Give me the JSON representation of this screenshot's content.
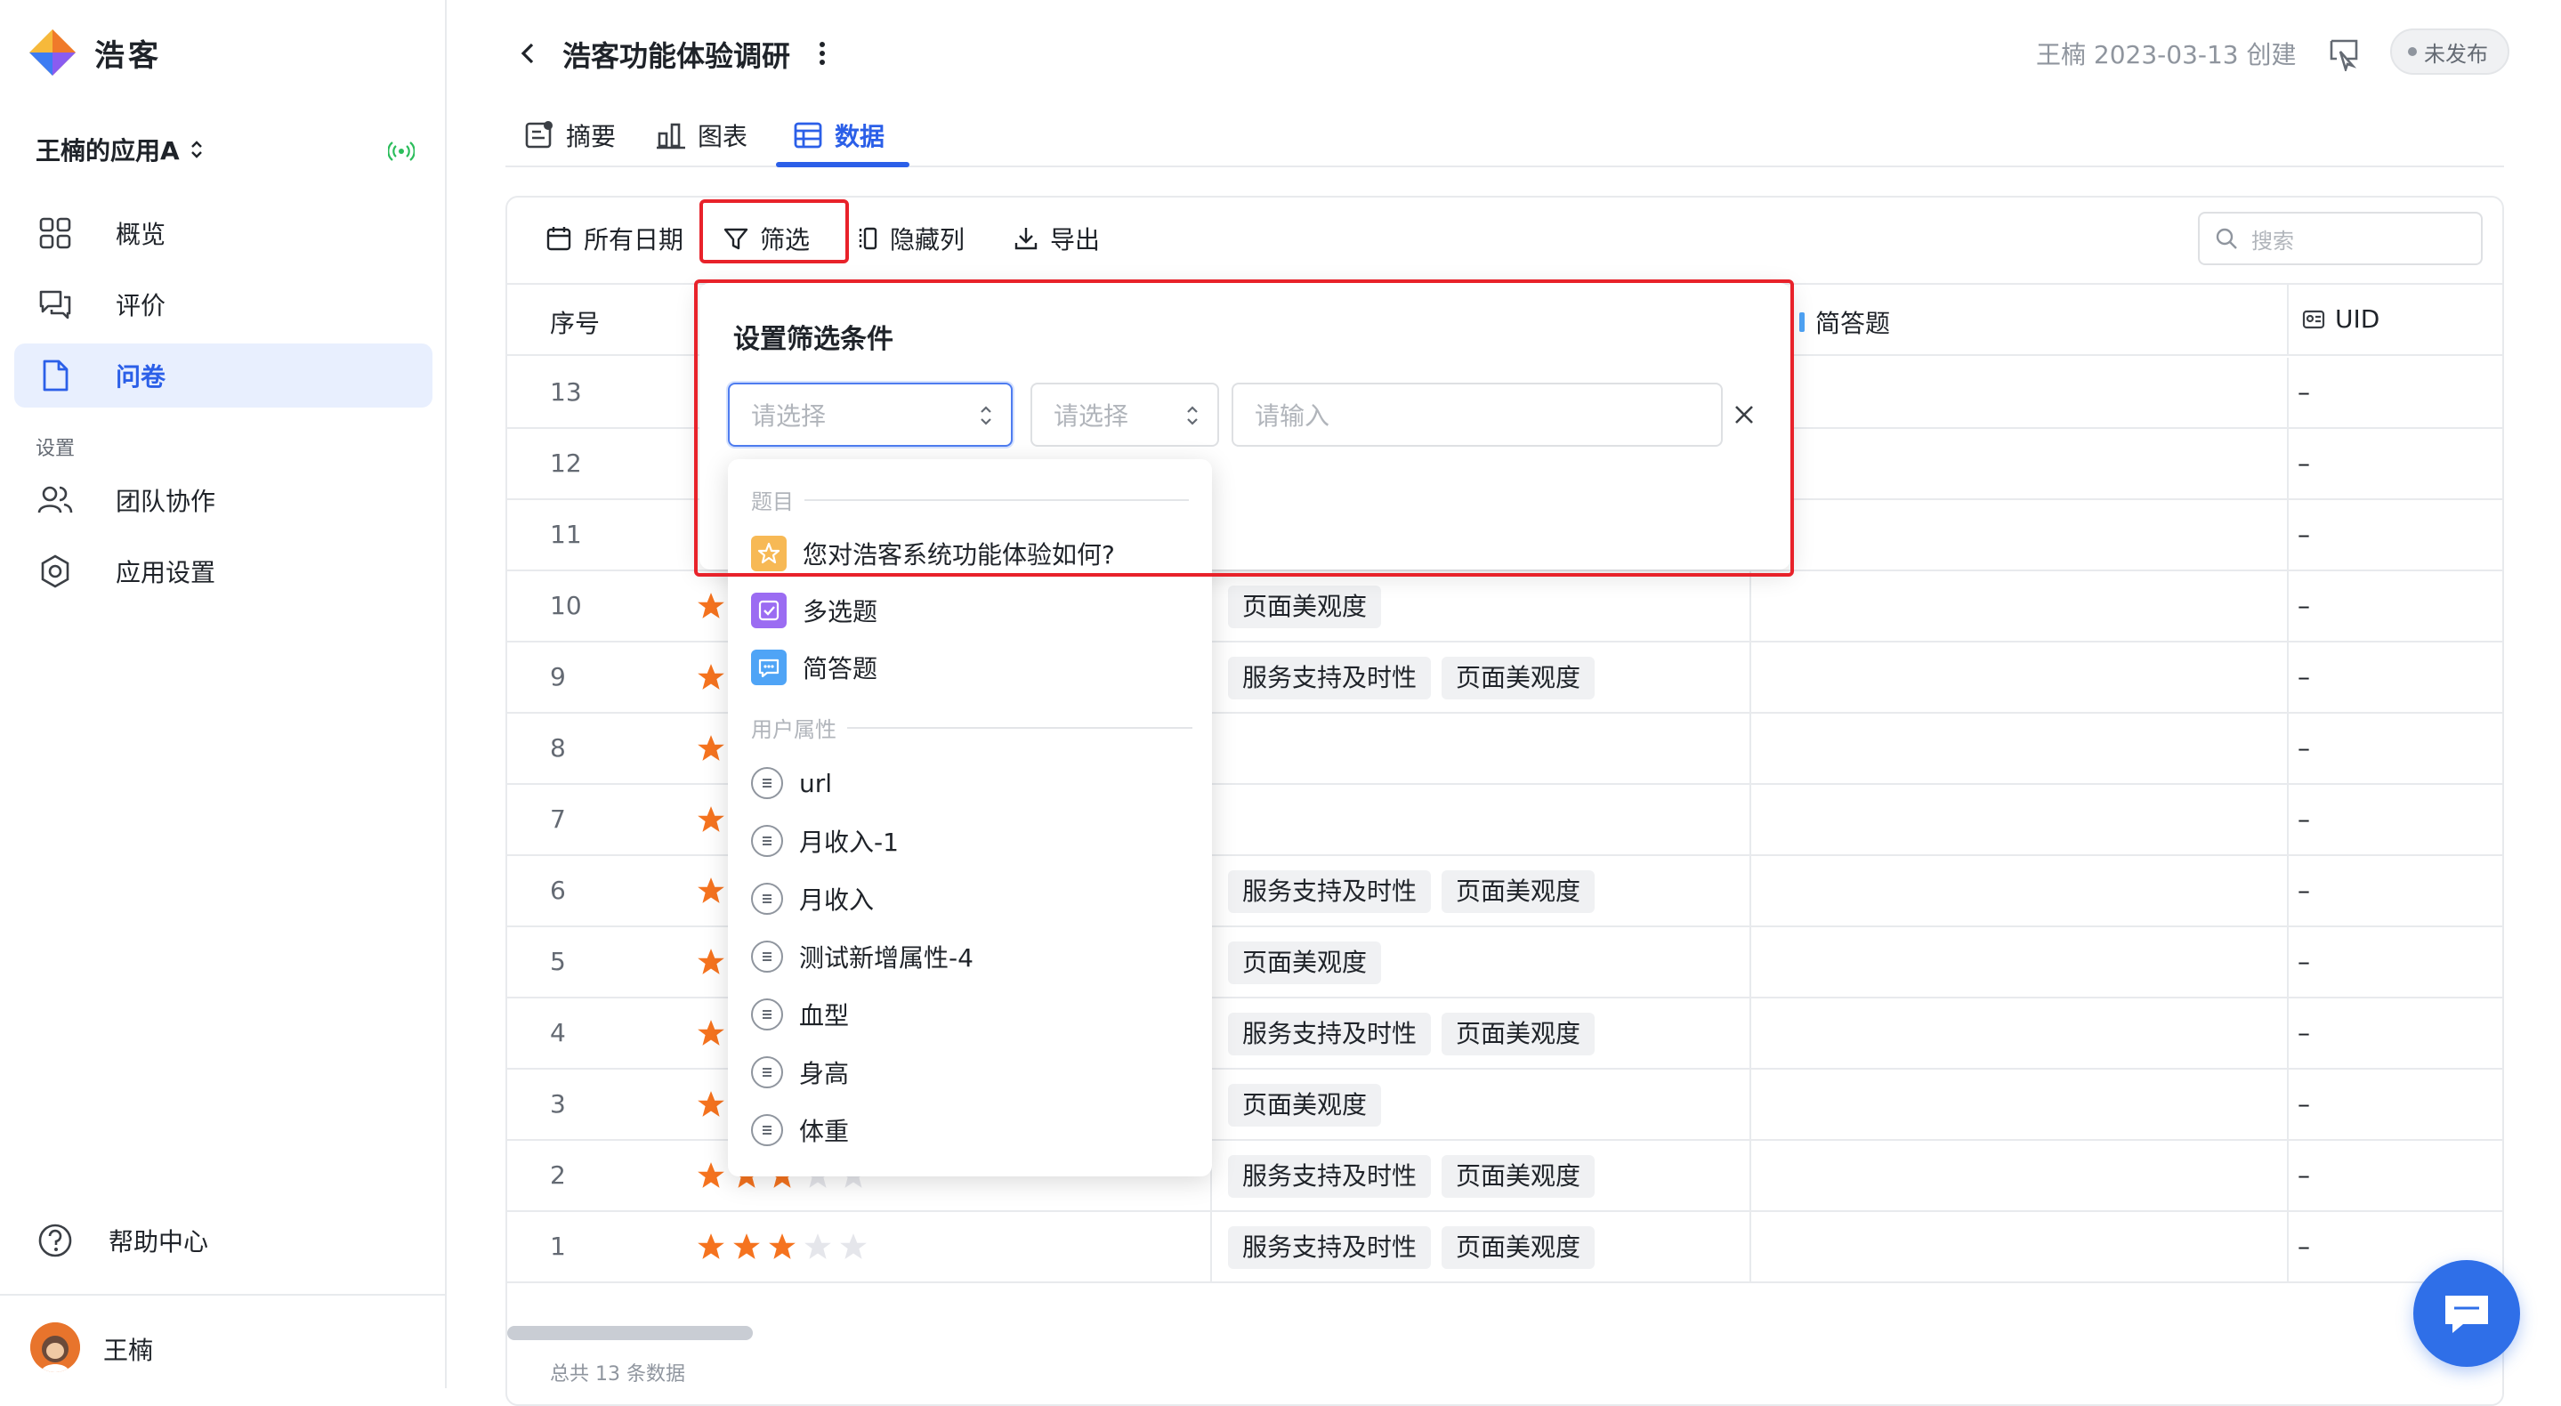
{
  "brand": {
    "name": "浩客"
  },
  "sidebar": {
    "app_name": "王楠的应用A",
    "items": [
      {
        "label": "概览",
        "icon": "grid-icon"
      },
      {
        "label": "评价",
        "icon": "chat-bubbles-icon"
      },
      {
        "label": "问卷",
        "icon": "document-icon",
        "active": true
      }
    ],
    "settings_group": "设置",
    "settings_items": [
      {
        "label": "团队协作",
        "icon": "team-icon"
      },
      {
        "label": "应用设置",
        "icon": "gear-icon"
      }
    ],
    "help": "帮助中心",
    "user_name": "王楠"
  },
  "header": {
    "title": "浩客功能体验调研",
    "creator": "王楠 2023-03-13 创建",
    "status": "未发布"
  },
  "tabs": [
    {
      "label": "摘要",
      "icon": "summary-icon"
    },
    {
      "label": "图表",
      "icon": "chart-icon"
    },
    {
      "label": "数据",
      "icon": "table-icon",
      "active": true
    }
  ],
  "toolbar": {
    "date": "所有日期",
    "filter": "筛选",
    "hide_columns": "隐藏列",
    "export": "导出",
    "search_placeholder": "搜索"
  },
  "table": {
    "columns": {
      "id": "序号",
      "short_answer": "简答题",
      "uid": "UID"
    },
    "rows": [
      {
        "id": "13",
        "stars": 0,
        "tags": [],
        "uid": "–"
      },
      {
        "id": "12",
        "stars": 0,
        "tags": [],
        "uid": "–"
      },
      {
        "id": "11",
        "stars": 0,
        "tags": [],
        "uid": "–"
      },
      {
        "id": "10",
        "stars": 1,
        "tags": [
          "页面美观度"
        ],
        "uid": "–"
      },
      {
        "id": "9",
        "stars": 1,
        "tags": [
          "服务支持及时性",
          "页面美观度"
        ],
        "uid": "–"
      },
      {
        "id": "8",
        "stars": 1,
        "tags": [],
        "uid": "–"
      },
      {
        "id": "7",
        "stars": 1,
        "tags": [],
        "uid": "–"
      },
      {
        "id": "6",
        "stars": 1,
        "tags": [
          "服务支持及时性",
          "页面美观度"
        ],
        "uid": "–"
      },
      {
        "id": "5",
        "stars": 1,
        "tags": [
          "页面美观度"
        ],
        "uid": "–"
      },
      {
        "id": "4",
        "stars": 1,
        "tags": [
          "服务支持及时性",
          "页面美观度"
        ],
        "uid": "–"
      },
      {
        "id": "3",
        "stars": 1,
        "tags": [
          "页面美观度"
        ],
        "uid": "–"
      },
      {
        "id": "2",
        "stars": 3,
        "tags": [
          "服务支持及时性",
          "页面美观度"
        ],
        "uid": "–"
      },
      {
        "id": "1",
        "stars": 3,
        "tags": [
          "服务支持及时性",
          "页面美观度"
        ],
        "uid": "–"
      }
    ],
    "total": "总共 13 条数据"
  },
  "filter_popover": {
    "title": "设置筛选条件",
    "field_placeholder": "请选择",
    "operator_placeholder": "请选择",
    "value_placeholder": "请输入",
    "dropdown": {
      "group_questions": "题目",
      "questions": [
        {
          "label": "您对浩客系统功能体验如何?",
          "icon": "star-icon",
          "color": "#f7b955"
        },
        {
          "label": "多选题",
          "icon": "checkbox-icon",
          "color": "#9b6cf2"
        },
        {
          "label": "简答题",
          "icon": "message-icon",
          "color": "#4fa4f6"
        }
      ],
      "group_attributes": "用户属性",
      "attributes": [
        "url",
        "月收入-1",
        "月收入",
        "测试新增属性-4",
        "血型",
        "身高",
        "体重"
      ]
    }
  },
  "colors": {
    "accent": "#2b5fe8",
    "star": "#f5731f",
    "star_empty": "#e5e6eb",
    "highlight": "#e8222a"
  }
}
